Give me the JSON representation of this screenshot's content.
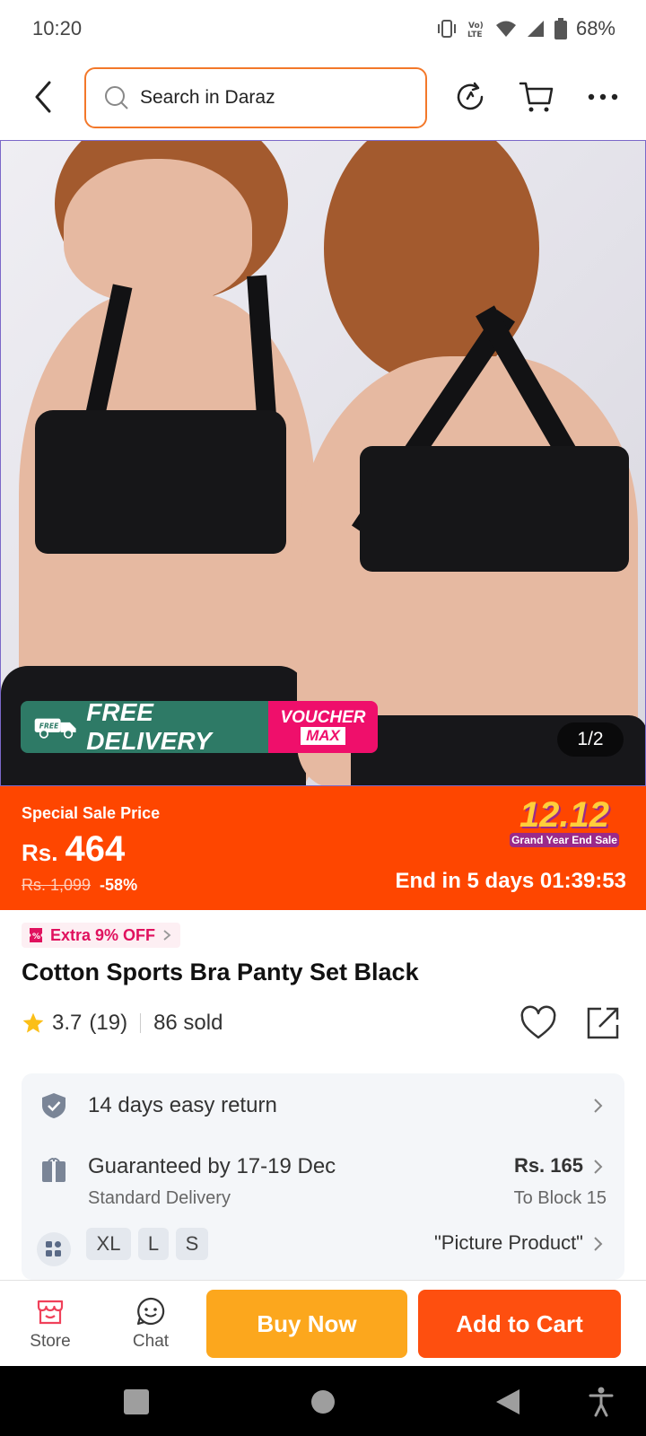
{
  "status_bar": {
    "time": "10:20",
    "battery": "68%",
    "icons": [
      "vibrate-icon",
      "volte-icon",
      "wifi-icon",
      "signal-icon",
      "battery-icon"
    ]
  },
  "nav": {
    "search_placeholder": "Search in Daraz",
    "icons": [
      "back-icon",
      "search-icon",
      "history-icon",
      "cart-icon",
      "more-icon"
    ]
  },
  "hero": {
    "free_delivery": "FREE DELIVERY",
    "free_tag": "FREE",
    "voucher_line1": "VOUCHER",
    "voucher_line2": "MAX",
    "image_counter": "1/2"
  },
  "price": {
    "label": "Special Sale Price",
    "currency": "Rs.",
    "value": "464",
    "original": "Rs. 1,099",
    "discount": "-58%",
    "campaign_big": "12.12",
    "campaign_small": "Grand Year End Sale",
    "countdown": "End in 5 days 01:39:53",
    "banner_color": "#fe4600"
  },
  "product": {
    "extra_off": "Extra 9% OFF",
    "title": "Cotton Sports Bra Panty Set Black",
    "rating": "3.7",
    "reviews": "(19)",
    "sold": "86 sold"
  },
  "info": {
    "return_text": "14 days easy return",
    "delivery_text": "Guaranteed by 17-19 Dec",
    "delivery_sub": "Standard Delivery",
    "shipping_fee": "Rs. 165",
    "ship_to": "To Block 15",
    "sizes": [
      "XL",
      "L",
      "S"
    ],
    "variant": "\"Picture Product\""
  },
  "actions": {
    "store": "Store",
    "chat": "Chat",
    "buy_now": "Buy Now",
    "add_to_cart": "Add to Cart"
  }
}
